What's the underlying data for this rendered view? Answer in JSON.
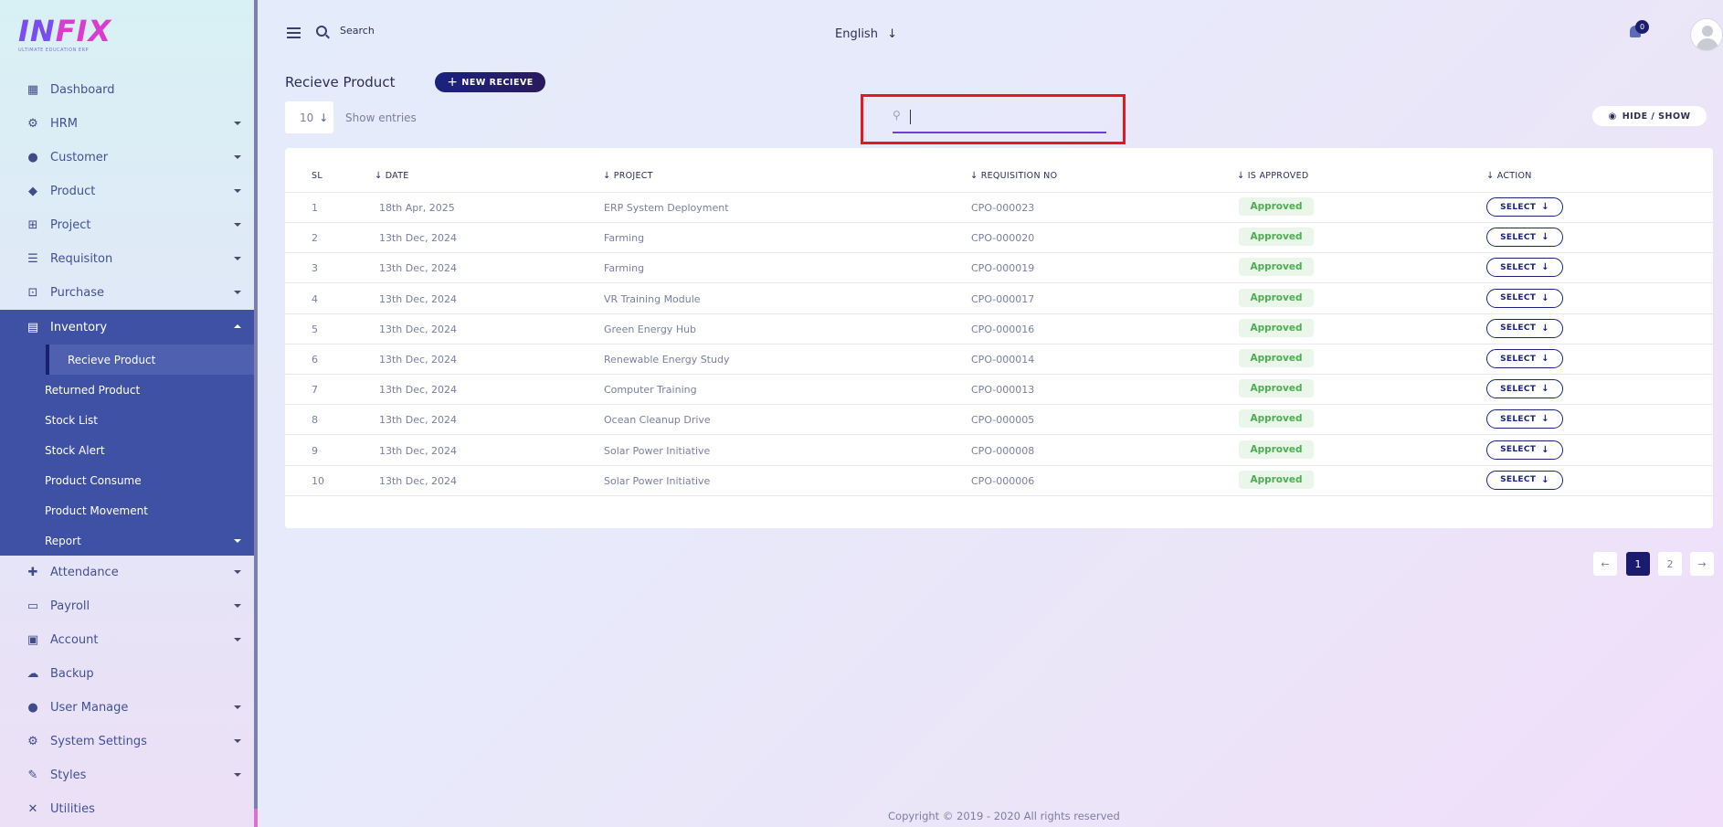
{
  "logo": {
    "brand": "INFIX",
    "tagline": "ULTIMATE EDUCATION ERP"
  },
  "sidebar": {
    "items": [
      {
        "label": "Dashboard",
        "icon": "grid-icon",
        "has_caret": false
      },
      {
        "label": "HRM",
        "icon": "users-cog-icon",
        "has_caret": true
      },
      {
        "label": "Customer",
        "icon": "user-icon",
        "has_caret": true
      },
      {
        "label": "Product",
        "icon": "tags-icon",
        "has_caret": true
      },
      {
        "label": "Project",
        "icon": "project-diagram-icon",
        "has_caret": true
      },
      {
        "label": "Requisiton",
        "icon": "list-icon",
        "has_caret": true
      },
      {
        "label": "Purchase",
        "icon": "cart-icon",
        "has_caret": true
      }
    ],
    "inventory": {
      "label": "Inventory",
      "icon": "warehouse-icon",
      "subitems": [
        "Recieve Product",
        "Returned Product",
        "Stock List",
        "Stock Alert",
        "Product Consume",
        "Product Movement",
        "Report"
      ],
      "active_subitem": "Recieve Product"
    },
    "items_after": [
      {
        "label": "Attendance",
        "icon": "user-plus-icon",
        "has_caret": true
      },
      {
        "label": "Payroll",
        "icon": "money-icon",
        "has_caret": true
      },
      {
        "label": "Account",
        "icon": "calculator-icon",
        "has_caret": true
      },
      {
        "label": "Backup",
        "icon": "cloud-download-icon",
        "has_caret": false
      },
      {
        "label": "User Manage",
        "icon": "users-icon",
        "has_caret": true
      },
      {
        "label": "System Settings",
        "icon": "gear-icon",
        "has_caret": true
      },
      {
        "label": "Styles",
        "icon": "brush-icon",
        "has_caret": true
      },
      {
        "label": "Utilities",
        "icon": "tools-icon",
        "has_caret": false
      }
    ]
  },
  "topbar": {
    "search_label": "Search",
    "language": "English",
    "notification_count": "0"
  },
  "page": {
    "title": "Recieve Product",
    "new_button": "NEW RECIEVE",
    "entries_value": "10",
    "entries_label": "Show entries",
    "hide_show": "HIDE / SHOW",
    "search_value": ""
  },
  "table": {
    "headers": [
      "SL",
      "DATE",
      "PROJECT",
      "REQUISITION NO",
      "IS APPROVED",
      "ACTION"
    ],
    "rows": [
      {
        "sl": "1",
        "date": "18th Apr, 2025",
        "project": "ERP System Deployment",
        "req": "CPO-000023",
        "status": "Approved",
        "action": "SELECT"
      },
      {
        "sl": "2",
        "date": "13th Dec, 2024",
        "project": "Farming",
        "req": "CPO-000020",
        "status": "Approved",
        "action": "SELECT"
      },
      {
        "sl": "3",
        "date": "13th Dec, 2024",
        "project": "Farming",
        "req": "CPO-000019",
        "status": "Approved",
        "action": "SELECT"
      },
      {
        "sl": "4",
        "date": "13th Dec, 2024",
        "project": "VR Training Module",
        "req": "CPO-000017",
        "status": "Approved",
        "action": "SELECT"
      },
      {
        "sl": "5",
        "date": "13th Dec, 2024",
        "project": "Green Energy Hub",
        "req": "CPO-000016",
        "status": "Approved",
        "action": "SELECT"
      },
      {
        "sl": "6",
        "date": "13th Dec, 2024",
        "project": "Renewable Energy Study",
        "req": "CPO-000014",
        "status": "Approved",
        "action": "SELECT"
      },
      {
        "sl": "7",
        "date": "13th Dec, 2024",
        "project": "Computer Training",
        "req": "CPO-000013",
        "status": "Approved",
        "action": "SELECT"
      },
      {
        "sl": "8",
        "date": "13th Dec, 2024",
        "project": "Ocean Cleanup Drive",
        "req": "CPO-000005",
        "status": "Approved",
        "action": "SELECT"
      },
      {
        "sl": "9",
        "date": "13th Dec, 2024",
        "project": "Solar Power Initiative",
        "req": "CPO-000008",
        "status": "Approved",
        "action": "SELECT"
      },
      {
        "sl": "10",
        "date": "13th Dec, 2024",
        "project": "Solar Power Initiative",
        "req": "CPO-000006",
        "status": "Approved",
        "action": "SELECT"
      }
    ]
  },
  "pagination": {
    "pages": [
      "1",
      "2"
    ],
    "current": "1"
  },
  "footer": "Copyright © 2019 - 2020 All rights reserved"
}
